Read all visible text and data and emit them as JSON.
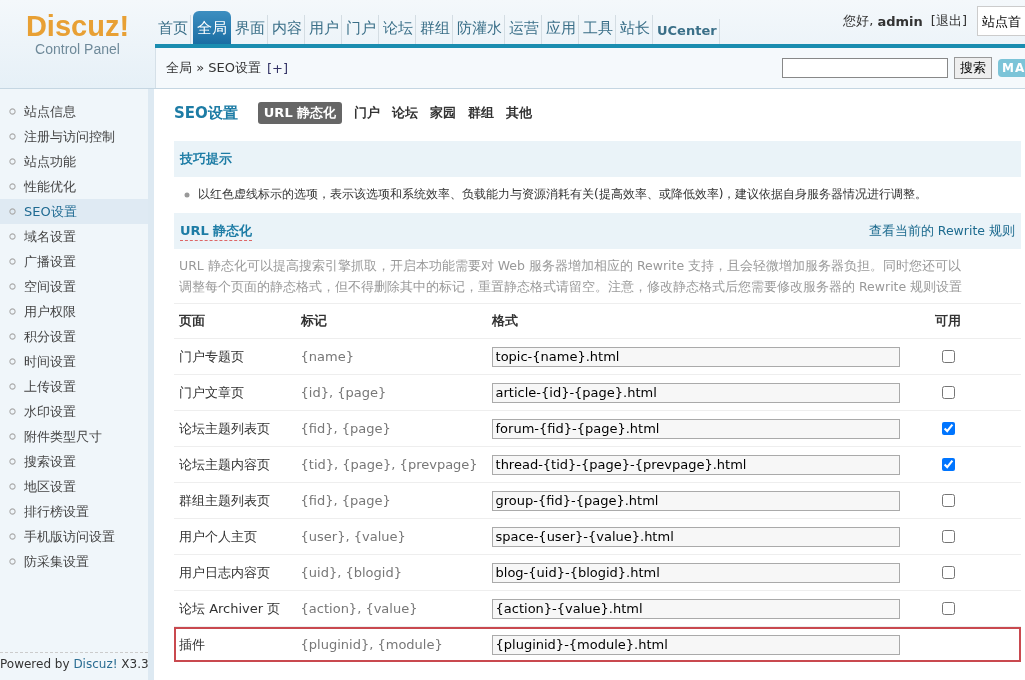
{
  "logo": {
    "brand": "Discuz!",
    "subtitle": "Control Panel"
  },
  "nav": [
    {
      "label": "首页",
      "selected": false
    },
    {
      "label": "全局",
      "selected": true
    },
    {
      "label": "界面",
      "selected": false
    },
    {
      "label": "内容",
      "selected": false
    },
    {
      "label": "用户",
      "selected": false
    },
    {
      "label": "门户",
      "selected": false
    },
    {
      "label": "论坛",
      "selected": false
    },
    {
      "label": "群组",
      "selected": false
    },
    {
      "label": "防灌水",
      "selected": false
    },
    {
      "label": "运营",
      "selected": false
    },
    {
      "label": "应用",
      "selected": false
    },
    {
      "label": "工具",
      "selected": false
    },
    {
      "label": "站长",
      "selected": false
    },
    {
      "label": "UCenter",
      "selected": false
    }
  ],
  "user": {
    "greeting": "您好,",
    "name": "admin",
    "logout": "[退出]",
    "site_button": "站点首"
  },
  "breadcrumb": {
    "path": "全局 » SEO设置",
    "add": "[+]"
  },
  "search": {
    "button": "搜索",
    "map_button": "MA"
  },
  "sidebar": {
    "items": [
      {
        "label": "站点信息",
        "selected": false
      },
      {
        "label": "注册与访问控制",
        "selected": false
      },
      {
        "label": "站点功能",
        "selected": false
      },
      {
        "label": "性能优化",
        "selected": false
      },
      {
        "label": "SEO设置",
        "selected": true
      },
      {
        "label": "域名设置",
        "selected": false
      },
      {
        "label": "广播设置",
        "selected": false
      },
      {
        "label": "空间设置",
        "selected": false
      },
      {
        "label": "用户权限",
        "selected": false
      },
      {
        "label": "积分设置",
        "selected": false
      },
      {
        "label": "时间设置",
        "selected": false
      },
      {
        "label": "上传设置",
        "selected": false
      },
      {
        "label": "水印设置",
        "selected": false
      },
      {
        "label": "附件类型尺寸",
        "selected": false
      },
      {
        "label": "搜索设置",
        "selected": false
      },
      {
        "label": "地区设置",
        "selected": false
      },
      {
        "label": "排行榜设置",
        "selected": false
      },
      {
        "label": "手机版访问设置",
        "selected": false
      },
      {
        "label": "防采集设置",
        "selected": false
      }
    ],
    "footer": "Powered by **Discuz!** X3.3"
  },
  "page": {
    "title": "SEO设置",
    "tabs": [
      {
        "label": "URL 静态化",
        "selected": true
      },
      {
        "label": "门户",
        "selected": false
      },
      {
        "label": "论坛",
        "selected": false
      },
      {
        "label": "家园",
        "selected": false
      },
      {
        "label": "群组",
        "selected": false
      },
      {
        "label": "其他",
        "selected": false
      }
    ]
  },
  "tips": {
    "title": "技巧提示",
    "items": [
      "以红色虚线标示的选项，表示该选项和系统效率、负载能力与资源消耗有关(提高效率、或降低效率)，建议依据自身服务器情况进行调整。"
    ]
  },
  "section": {
    "title": "URL 静态化",
    "link": "查看当前的 Rewrite 规则",
    "description": "URL 静态化可以提高搜索引擎抓取，开启本功能需要对 Web 服务器增加相应的 Rewrite 支持，且会轻微增加服务器负担。同时您还可以调整每个页面的静态格式，但不得删除其中的标记，重置静态格式请留空。注意，修改静态格式后您需要修改服务器的 Rewrite 规则设置"
  },
  "table": {
    "columns": [
      "页面",
      "标记",
      "格式",
      "可用"
    ],
    "rows": [
      {
        "page": "门户专题页",
        "marks": "{name}",
        "format": "topic-{name}.html",
        "checked": false,
        "highlighted": false
      },
      {
        "page": "门户文章页",
        "marks": "{id}, {page}",
        "format": "article-{id}-{page}.html",
        "checked": false,
        "highlighted": false
      },
      {
        "page": "论坛主题列表页",
        "marks": "{fid}, {page}",
        "format": "forum-{fid}-{page}.html",
        "checked": true,
        "highlighted": false
      },
      {
        "page": "论坛主题内容页",
        "marks": "{tid}, {page}, {prevpage}",
        "format": "thread-{tid}-{page}-{prevpage}.html",
        "checked": true,
        "highlighted": false
      },
      {
        "page": "群组主题列表页",
        "marks": "{fid}, {page}",
        "format": "group-{fid}-{page}.html",
        "checked": false,
        "highlighted": false
      },
      {
        "page": "用户个人主页",
        "marks": "{user}, {value}",
        "format": "space-{user}-{value}.html",
        "checked": false,
        "highlighted": false
      },
      {
        "page": "用户日志内容页",
        "marks": "{uid}, {blogid}",
        "format": "blog-{uid}-{blogid}.html",
        "checked": false,
        "highlighted": false
      },
      {
        "page": "论坛 Archiver 页",
        "marks": "{action}, {value}",
        "format": "{action}-{value}.html",
        "checked": false,
        "highlighted": false
      },
      {
        "page": "插件",
        "marks": "{pluginid}, {module}",
        "format": "{pluginid}-{module}.html",
        "highlighted": true
      }
    ]
  }
}
